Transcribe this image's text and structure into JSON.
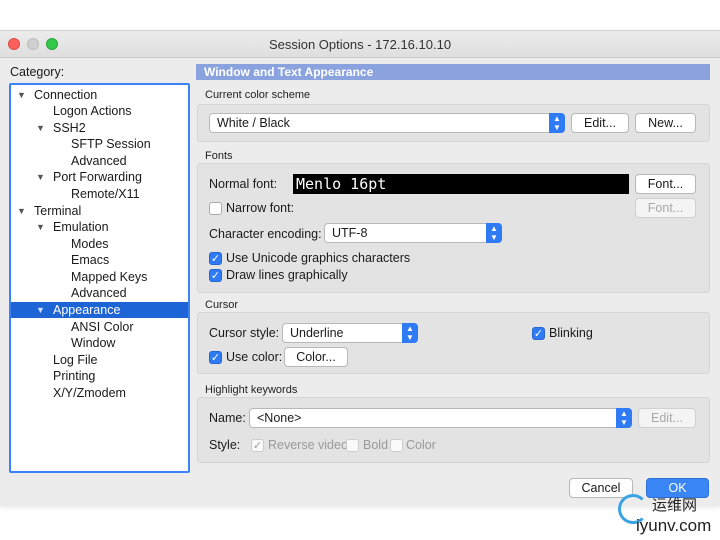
{
  "window": {
    "title": "Session Options - 172.16.10.10"
  },
  "category": {
    "label": "Category:",
    "items": [
      {
        "label": "Connection",
        "twisty": "▼"
      },
      {
        "label": "Logon Actions",
        "twisty": ""
      },
      {
        "label": "SSH2",
        "twisty": "▼"
      },
      {
        "label": "SFTP Session",
        "twisty": ""
      },
      {
        "label": "Advanced",
        "twisty": ""
      },
      {
        "label": "Port Forwarding",
        "twisty": "▼"
      },
      {
        "label": "Remote/X11",
        "twisty": ""
      },
      {
        "label": "Terminal",
        "twisty": "▼"
      },
      {
        "label": "Emulation",
        "twisty": "▼"
      },
      {
        "label": "Modes",
        "twisty": ""
      },
      {
        "label": "Emacs",
        "twisty": ""
      },
      {
        "label": "Mapped Keys",
        "twisty": ""
      },
      {
        "label": "Advanced",
        "twisty": ""
      },
      {
        "label": "Appearance",
        "twisty": "▼"
      },
      {
        "label": "ANSI Color",
        "twisty": ""
      },
      {
        "label": "Window",
        "twisty": ""
      },
      {
        "label": "Log File",
        "twisty": ""
      },
      {
        "label": "Printing",
        "twisty": ""
      },
      {
        "label": "X/Y/Zmodem",
        "twisty": ""
      }
    ]
  },
  "panel": {
    "header": "Window and Text Appearance",
    "color_scheme": {
      "group_label": "Current color scheme",
      "value": "White / Black",
      "edit_button": "Edit...",
      "new_button": "New..."
    },
    "fonts": {
      "group_label": "Fonts",
      "normal_font_label": "Normal font:",
      "normal_font_value": "Menlo 16pt",
      "font_button": "Font...",
      "narrow_font_label": "Narrow font:",
      "narrow_font_button": "Font...",
      "encoding_label": "Character encoding:",
      "encoding_value": "UTF-8",
      "unicode_label": "Use Unicode graphics characters",
      "draw_lines_label": "Draw lines graphically"
    },
    "cursor": {
      "group_label": "Cursor",
      "style_label": "Cursor style:",
      "style_value": "Underline",
      "blinking_label": "Blinking",
      "use_color_label": "Use color:",
      "color_button": "Color..."
    },
    "highlight": {
      "group_label": "Highlight keywords",
      "name_label": "Name:",
      "name_value": "<None>",
      "edit_button": "Edit...",
      "style_label": "Style:",
      "reverse_label": "Reverse video",
      "bold_label": "Bold",
      "color_label": "Color"
    }
  },
  "footer": {
    "cancel_button": "Cancel",
    "ok_button": "OK"
  },
  "watermark": {
    "cn": "运维网",
    "url": "iyunv.com"
  },
  "colors": {
    "accent": "#2f7bf5",
    "selection": "#1d64d6",
    "header": "#8aa3de"
  }
}
